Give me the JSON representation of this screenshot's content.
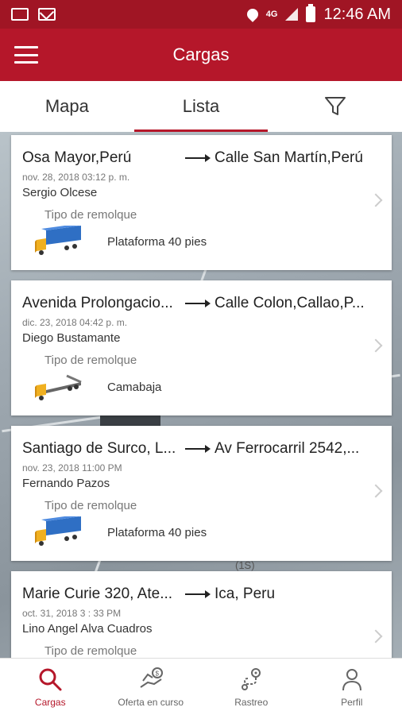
{
  "status_bar": {
    "time": "12:46 AM",
    "network": "4G"
  },
  "app_bar": {
    "title": "Cargas"
  },
  "tabs": [
    {
      "label": "Mapa",
      "active": false
    },
    {
      "label": "Lista",
      "active": true
    }
  ],
  "map": {
    "label": "(1S)"
  },
  "cards": [
    {
      "origin": "Osa Mayor,Perú",
      "destination": "Calle San Martín,Perú",
      "date": "nov. 28, 2018 03:12 p. m.",
      "name": "Sergio Olcese",
      "trailer_label": "Tipo de remolque",
      "trailer_type": "Plataforma 40 pies",
      "truck_icon": "flatbed-truck-icon"
    },
    {
      "origin": "Avenida Prolongacio...",
      "destination": "Calle Colon,Callao,P...",
      "date": "dic. 23, 2018 04:42 p. m.",
      "name": "Diego Bustamante",
      "trailer_label": "Tipo de remolque",
      "trailer_type": "Camabaja",
      "truck_icon": "lowbed-truck-icon"
    },
    {
      "origin": "Santiago de Surco, L...",
      "destination": "Av Ferrocarril 2542,...",
      "date": "nov. 23, 2018 11:00 PM",
      "name": "Fernando  Pazos",
      "trailer_label": "Tipo de remolque",
      "trailer_type": "Plataforma 40 pies",
      "truck_icon": "flatbed-truck-icon"
    },
    {
      "origin": "Marie Curie 320, Ate...",
      "destination": "Ica, Peru",
      "date": "oct. 31, 2018 3 : 33 PM",
      "name": "Lino Angel Alva Cuadros",
      "trailer_label": "Tipo de remolque",
      "trailer_type": "",
      "truck_icon": "flatbed-truck-icon"
    }
  ],
  "bottom_nav": [
    {
      "label": "Cargas",
      "icon": "search-icon",
      "active": true
    },
    {
      "label": "Oferta en curso",
      "icon": "offer-icon",
      "active": false
    },
    {
      "label": "Rastreo",
      "icon": "route-icon",
      "active": false
    },
    {
      "label": "Perfil",
      "icon": "profile-icon",
      "active": false
    }
  ],
  "colors": {
    "primary": "#b5172a",
    "status": "#a01524"
  }
}
